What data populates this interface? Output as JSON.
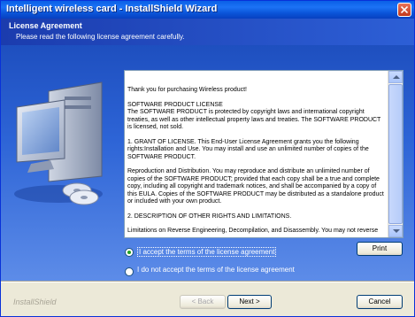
{
  "window": {
    "title": "Intelligent wireless card - InstallShield Wizard"
  },
  "header": {
    "title": "License Agreement",
    "subtitle": "Please read the following license agreement carefully."
  },
  "license": {
    "paragraphs": [
      "Thank you for purchasing Wireless product!",
      "SOFTWARE PRODUCT LICENSE\nThe SOFTWARE PRODUCT is protected by copyright laws and international copyright treaties, as well as other intellectual property laws and treaties. The SOFTWARE PRODUCT is licensed, not sold.",
      "1. GRANT OF LICENSE. This End-User License Agreement grants you the following rights:Installation and Use. You may install and use an unlimited number of copies of the SOFTWARE PRODUCT.",
      "Reproduction and Distribution. You may reproduce and distribute an unlimited number of copies of the SOFTWARE PRODUCT; provided that each copy shall be a true and complete copy, including all copyright and trademark notices, and shall be accompanied by a copy of this EULA. Copies of the SOFTWARE PRODUCT may be distributed as a standalone product or included with your own product.",
      "2. DESCRIPTION OF OTHER RIGHTS AND LIMITATIONS.",
      "Limitations on Reverse Engineering, Decompilation, and Disassembly. You may not reverse"
    ]
  },
  "options": {
    "accept_label": "I accept the terms of the license agreement",
    "decline_label": "I do not accept the terms of the license agreement",
    "selected": "accept"
  },
  "buttons": {
    "print": "Print",
    "back": "< Back",
    "next": "Next >",
    "cancel": "Cancel"
  },
  "footer": {
    "brand": "InstallShield"
  },
  "colors": {
    "title_bar": "#0a54d8",
    "panel": "#2d64d6",
    "dialog": "#ece9d8"
  }
}
